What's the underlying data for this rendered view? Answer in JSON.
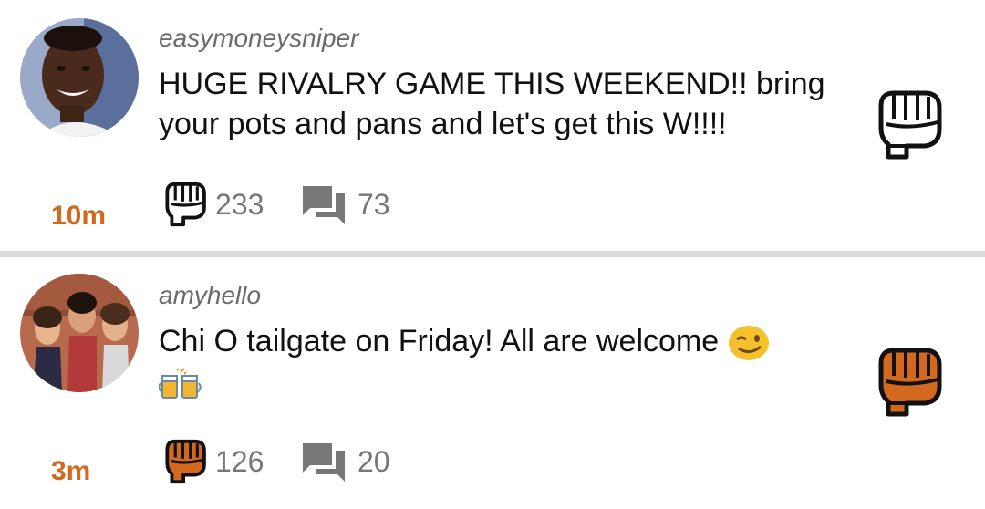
{
  "posts": [
    {
      "username": "easymoneysniper",
      "message": "HUGE RIVALRY GAME THIS WEEKEND!! bring your pots and pans and let's get this W!!!!",
      "time": "10m",
      "fist_count": "233",
      "comment_count": "73",
      "fisted": false,
      "avatar_icon": "avatar-photo",
      "colors": {
        "fist": "#ffffff",
        "stroke": "#111111"
      }
    },
    {
      "username": "amyhello",
      "message": "Chi O tailgate on Friday! All are welcome",
      "time": "3m",
      "fist_count": "126",
      "comment_count": "20",
      "fisted": true,
      "emojis": [
        "winking-face-emoji",
        "clinking-beer-mugs-emoji"
      ],
      "avatar_icon": "avatar-photo",
      "colors": {
        "fist": "#d2691e",
        "stroke": "#111111"
      }
    }
  ],
  "colors": {
    "time_accent": "#d2691e",
    "count_gray": "#777777",
    "divider": "#dcdcdc"
  }
}
